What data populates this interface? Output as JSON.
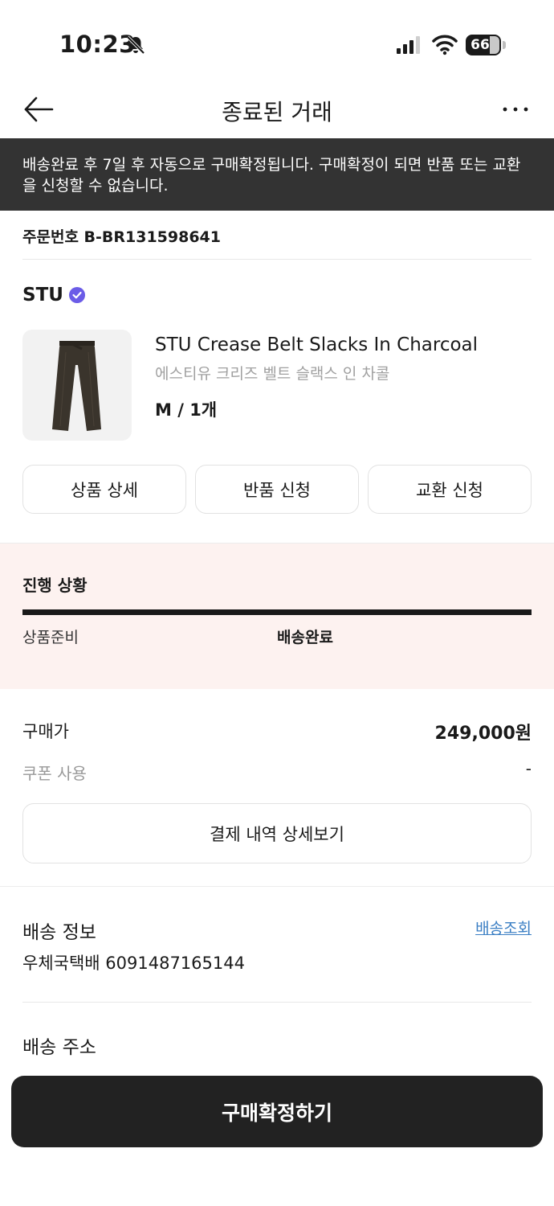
{
  "status_bar": {
    "time": "10:23",
    "battery": "66"
  },
  "nav": {
    "title": "종료된 거래"
  },
  "banner": {
    "text": "배송완료 후 7일 후 자동으로 구매확정됩니다. 구매확정이 되면 반품 또는 교환을 신청할 수 없습니다."
  },
  "order": {
    "number_label": "주문번호 B-BR131598641"
  },
  "product": {
    "brand": "STU",
    "name": "STU Crease Belt Slacks In Charcoal",
    "name_kr": "에스티유 크리즈 벨트 슬랙스 인 차콜",
    "option": "M / 1개",
    "actions": [
      "상품 상세",
      "반품 신청",
      "교환 신청"
    ]
  },
  "progress": {
    "title": "진행 상황",
    "stages": [
      "상품준비",
      "배송완료"
    ],
    "current_stage": "배송완료"
  },
  "price": {
    "label": "구매가",
    "value": "249,000원",
    "coupon_label": "쿠폰 사용",
    "coupon_value": "-",
    "details_button": "결제 내역 상세보기"
  },
  "shipping": {
    "title": "배송 정보",
    "track_link": "배송조회",
    "carrier": "우체국택배 6091487165144",
    "address_title": "배송 주소"
  },
  "footer": {
    "confirm_button": "구매확정하기"
  },
  "colors": {
    "banner_bg": "#333333",
    "progress_bg": "#fdf2f0",
    "link": "#3b7fc4",
    "verified": "#6b5ce7",
    "primary_button": "#222222"
  }
}
